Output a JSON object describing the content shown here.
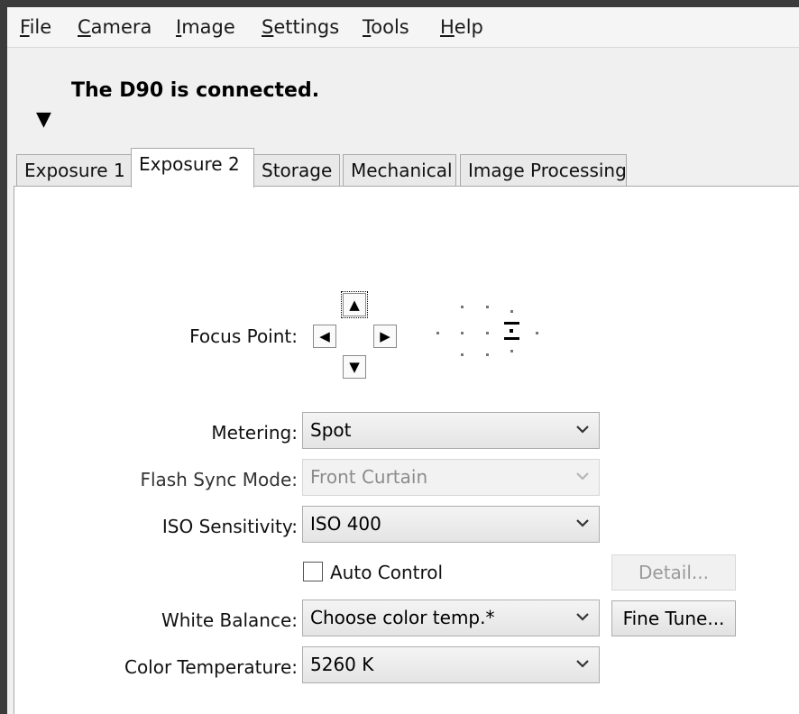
{
  "menu": [
    "File",
    "Camera",
    "Image",
    "Settings",
    "Tools",
    "Help"
  ],
  "status": "The D90 is connected.",
  "tabs": [
    "Exposure 1",
    "Exposure 2",
    "Storage",
    "Mechanical",
    "Image Processing"
  ],
  "active_tab": "Exposure 2",
  "focus_point": {
    "label": "Focus Point:"
  },
  "fields": {
    "metering": {
      "label": "Metering:",
      "value": "Spot"
    },
    "flash_sync": {
      "label": "Flash Sync Mode:",
      "value": "Front Curtain",
      "disabled": true
    },
    "iso": {
      "label": "ISO Sensitivity:",
      "value": "ISO 400"
    },
    "auto_control": {
      "label": "Auto Control",
      "checked": false
    },
    "detail_button": {
      "label": "Detail...",
      "disabled": true
    },
    "white_balance": {
      "label": "White Balance:",
      "value": "Choose color temp.*"
    },
    "fine_tune_button": {
      "label": "Fine Tune..."
    },
    "color_temperature": {
      "label": "Color Temperature:",
      "value": "5260 K"
    }
  }
}
